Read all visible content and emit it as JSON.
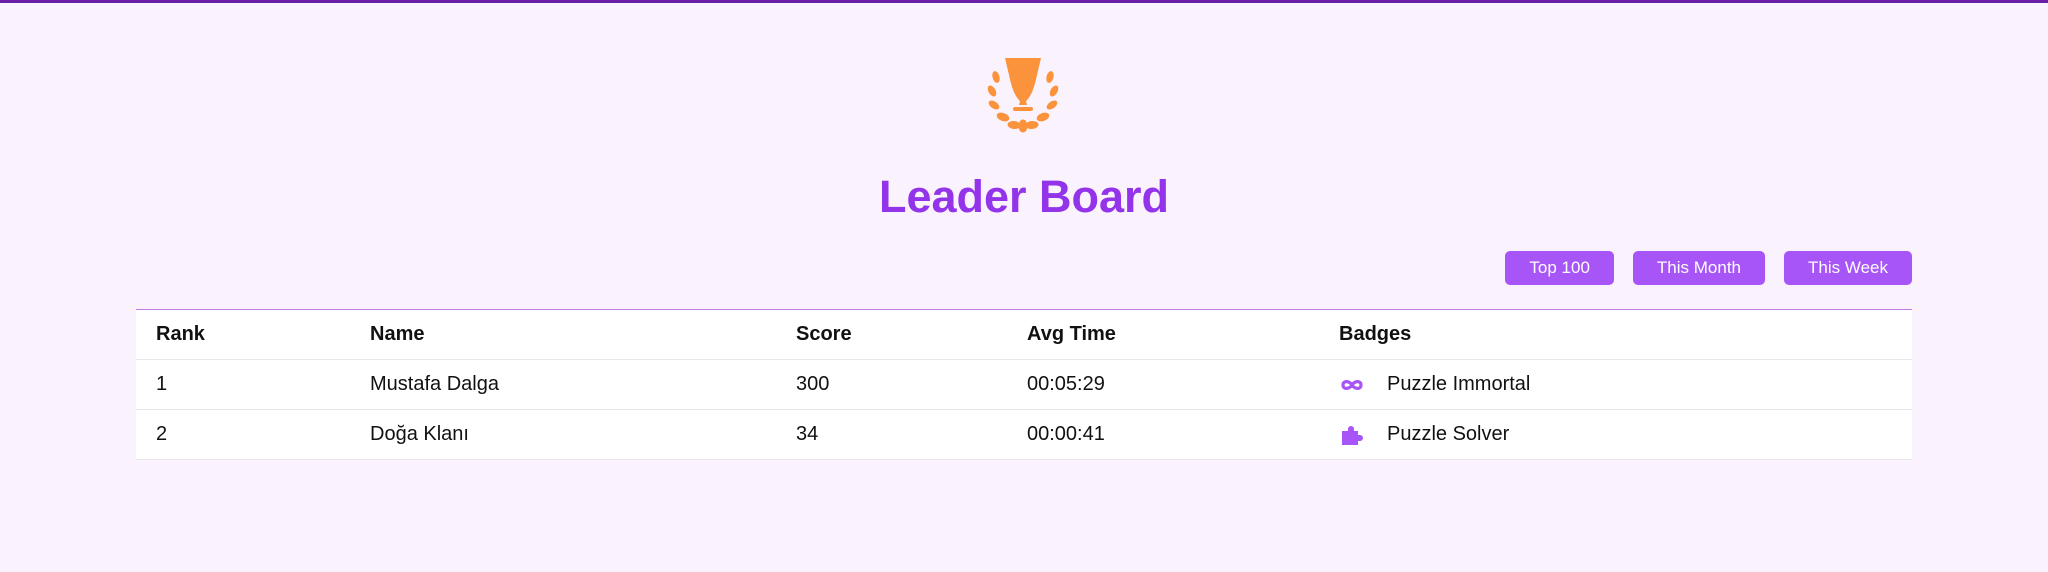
{
  "colors": {
    "accent": "#a855f7",
    "title": "#9333ea",
    "trophy": "#fb923c",
    "top_bar": "#6a1fa8",
    "background": "#faf3fd"
  },
  "header": {
    "icon": "trophy-laurel-icon",
    "title": "Leader Board"
  },
  "filters": [
    "Top 100",
    "This Month",
    "This Week"
  ],
  "table": {
    "columns": [
      "Rank",
      "Name",
      "Score",
      "Avg Time",
      "Badges"
    ],
    "rows": [
      {
        "rank": "1",
        "name": "Mustafa Dalga",
        "score": "300",
        "avg_time": "00:05:29",
        "badge_icon": "infinity-icon",
        "badge": "Puzzle Immortal"
      },
      {
        "rank": "2",
        "name": "Doğa Klanı",
        "score": "34",
        "avg_time": "00:00:41",
        "badge_icon": "puzzle-piece-icon",
        "badge": "Puzzle Solver"
      }
    ]
  }
}
